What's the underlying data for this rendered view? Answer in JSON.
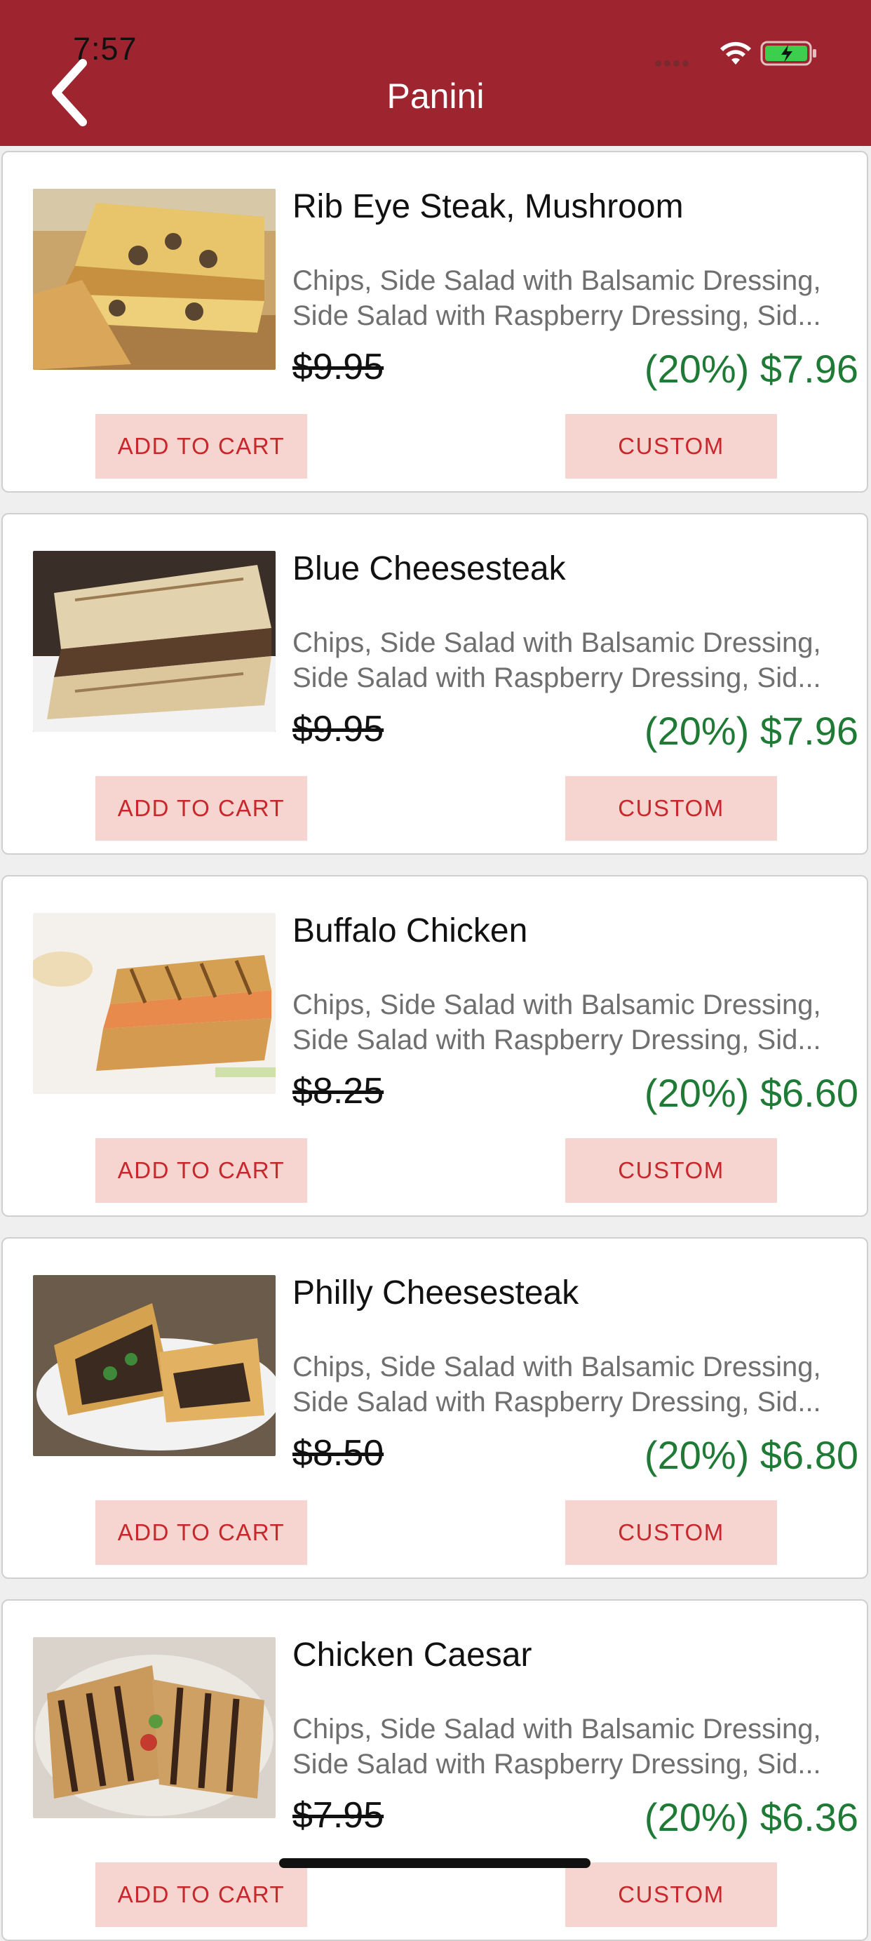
{
  "status_bar": {
    "time": "7:57"
  },
  "header": {
    "title": "Panini"
  },
  "items": [
    {
      "name": "Rib Eye Steak, Mushroom",
      "desc_line1": "Chips, Side Salad with Balsamic Dressing,",
      "desc_line2": "Side Salad with Raspberry Dressing, Sid...",
      "old_price": "$9.95",
      "new_price": "(20%) $7.96",
      "add_label": "ADD TO CART",
      "custom_label": "CUSTOM"
    },
    {
      "name": "Blue Cheesesteak",
      "desc_line1": "Chips, Side Salad with Balsamic Dressing,",
      "desc_line2": "Side Salad with Raspberry Dressing, Sid...",
      "old_price": "$9.95",
      "new_price": "(20%) $7.96",
      "add_label": "ADD TO CART",
      "custom_label": "CUSTOM"
    },
    {
      "name": "Buffalo Chicken",
      "desc_line1": "Chips, Side Salad with Balsamic Dressing,",
      "desc_line2": "Side Salad with Raspberry Dressing, Sid...",
      "old_price": "$8.25",
      "new_price": "(20%) $6.60",
      "add_label": "ADD TO CART",
      "custom_label": "CUSTOM"
    },
    {
      "name": "Philly Cheesesteak",
      "desc_line1": "Chips, Side Salad with Balsamic Dressing,",
      "desc_line2": "Side Salad with Raspberry Dressing, Sid...",
      "old_price": "$8.50",
      "new_price": "(20%) $6.80",
      "add_label": "ADD TO CART",
      "custom_label": "CUSTOM"
    },
    {
      "name": "Chicken Caesar",
      "desc_line1": "Chips, Side Salad with Balsamic Dressing,",
      "desc_line2": "Side Salad with Raspberry Dressing, Sid...",
      "old_price": "$7.95",
      "new_price": "(20%) $6.36",
      "add_label": "ADD TO CART",
      "custom_label": "CUSTOM"
    }
  ],
  "colors": {
    "header_bg": "#9e2530",
    "price_green": "#1f7a35",
    "button_bg": "#f6d4cf",
    "button_text": "#c8282c"
  }
}
